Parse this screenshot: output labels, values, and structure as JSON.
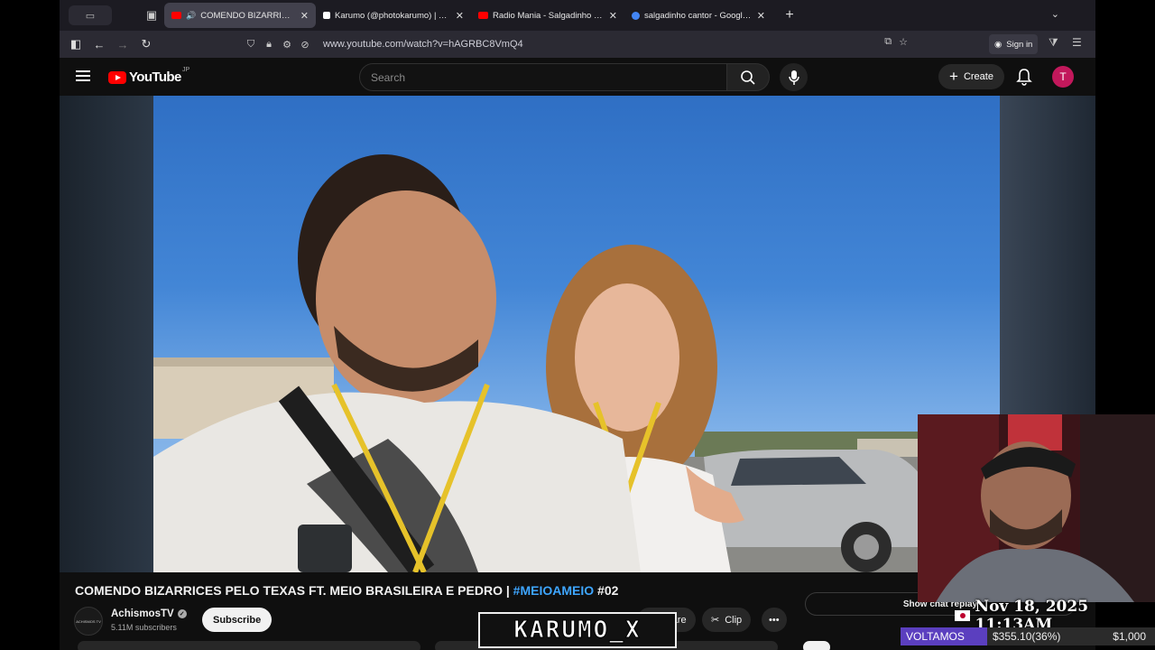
{
  "browser": {
    "tabs": [
      {
        "title": "COMENDO BIZARRICES PELO TEXAS FT. MEIO BRASILEIRA E PEDRO",
        "active": true,
        "favicon_color": "#ff0000",
        "audio": true
      },
      {
        "title": "Karumo (@photokarumo) | TikTok",
        "active": false,
        "favicon_color": "#ffffff"
      },
      {
        "title": "Radio Mania - Salgadinho - Ainda Bem",
        "active": false,
        "favicon_color": "#ff0000"
      },
      {
        "title": "salgadinho cantor - Google Search",
        "active": false,
        "favicon_color": "#4285f4"
      }
    ],
    "url": "www.youtube.com/watch?v=hAGRBC8VmQ4",
    "signin_label": "Sign in"
  },
  "youtube": {
    "logo_text": "YouTube",
    "region": "JP",
    "search_placeholder": "Search",
    "create_label": "Create",
    "avatar_letter": "T"
  },
  "video": {
    "title_main": "COMENDO BIZARRICES PELO TEXAS FT. MEIO BRASILEIRA E PEDRO | ",
    "title_tag": "#MEIOAMEIO",
    "title_tail": " #02",
    "channel_name": "AchismosTV",
    "channel_avatar_text": "ACHISMOS TV",
    "subscribers": "5.11M subscribers",
    "subscribe_label": "Subscribe",
    "share_label": "Share",
    "clip_label": "Clip",
    "chat_replay_label": "Show chat replay"
  },
  "overlay": {
    "watermark": "KARUMO_X",
    "datetime": "Nov 18, 2025 11:13AM",
    "ticker_label": "VOLTAMOS",
    "ticker_value": "$355.10(36%)",
    "ticker_goal": "$1,000"
  },
  "colors": {
    "accent_red": "#ff0000",
    "hashtag_blue": "#3ea6ff",
    "avatar_pink": "#c2185b",
    "ticker_purple": "#5b3fbf"
  }
}
